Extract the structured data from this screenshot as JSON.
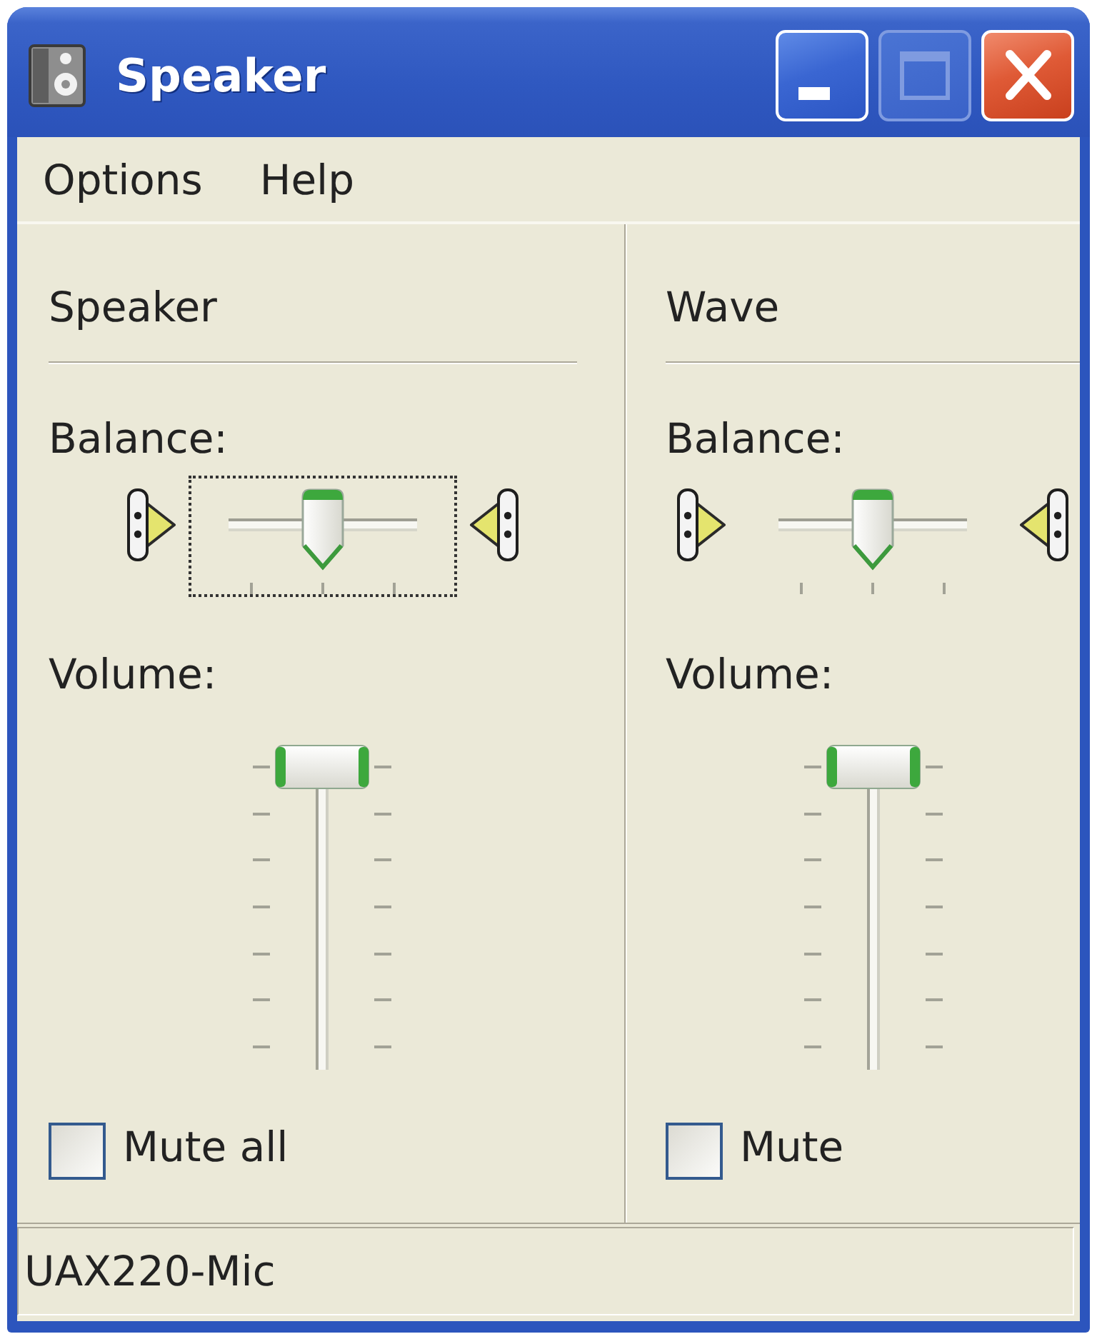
{
  "window": {
    "title": "Speaker",
    "buttons": [
      {
        "kind": "minimize",
        "disabled": false
      },
      {
        "kind": "maximize",
        "disabled": true
      },
      {
        "kind": "close",
        "disabled": false
      }
    ]
  },
  "menu": [
    {
      "label": "Options"
    },
    {
      "label": "Help"
    }
  ],
  "channels": [
    {
      "name": "Speaker",
      "balance_label": "Balance:",
      "balance": {
        "level": 0.5,
        "focused": true
      },
      "volume_label": "Volume:",
      "volume": {
        "level": 1
      },
      "mute": {
        "label": "Mute all",
        "checked": false
      }
    },
    {
      "name": "Wave",
      "balance_label": "Balance:",
      "balance": {
        "level": 0.5,
        "focused": false
      },
      "volume_label": "Volume:",
      "volume": {
        "level": 1
      },
      "mute": {
        "label": "Mute",
        "checked": false
      }
    }
  ],
  "status_bar": {
    "text": "UAX220-Mic"
  }
}
